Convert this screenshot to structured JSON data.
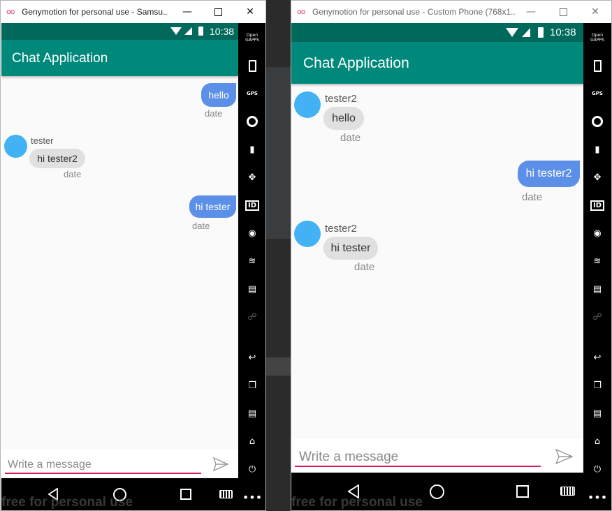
{
  "left_window": {
    "title": "Genymotion for personal use - Samsu...",
    "status_time": "10:38",
    "app_title": "Chat Application",
    "messages": [
      {
        "dir": "out",
        "text": "hello",
        "date": "date"
      },
      {
        "dir": "in",
        "sender": "tester",
        "text": "hi tester2",
        "date": "date"
      },
      {
        "dir": "out",
        "text": "hi tester",
        "date": "date"
      }
    ],
    "input_placeholder": "Write a message",
    "watermark": "free for personal use"
  },
  "right_window": {
    "title": "Genymotion for personal use - Custom Phone (768x1...",
    "status_time": "10:38",
    "app_title": "Chat Application",
    "messages": [
      {
        "dir": "in",
        "sender": "tester2",
        "text": "hello",
        "date": "date"
      },
      {
        "dir": "out",
        "text": "hi tester2",
        "date": "date"
      },
      {
        "dir": "in",
        "sender": "tester2",
        "text": "hi tester",
        "date": "date"
      }
    ],
    "input_placeholder": "Write a message",
    "watermark": "free for personal use"
  },
  "side_toolbar": {
    "items": [
      "open-gapps-icon",
      "battery-icon",
      "gps-icon",
      "webcam-icon",
      "screencast-icon",
      "dpad-icon",
      "device-id-icon",
      "disk-io-icon",
      "network-icon",
      "sms-icon",
      "share-icon",
      "back-icon",
      "recent-apps-icon",
      "menu-icon",
      "home-icon",
      "power-icon"
    ],
    "open_gapps_label": "Open GAPPS",
    "gps_label": "GPS",
    "id_label": "ID"
  },
  "colors": {
    "app_bar": "#00897b",
    "status_bar": "#00695c",
    "outgoing_bubble": "#5c8fe8",
    "incoming_bubble": "#e0e0e0",
    "avatar": "#42b2f5",
    "input_underline": "#d81b60"
  }
}
